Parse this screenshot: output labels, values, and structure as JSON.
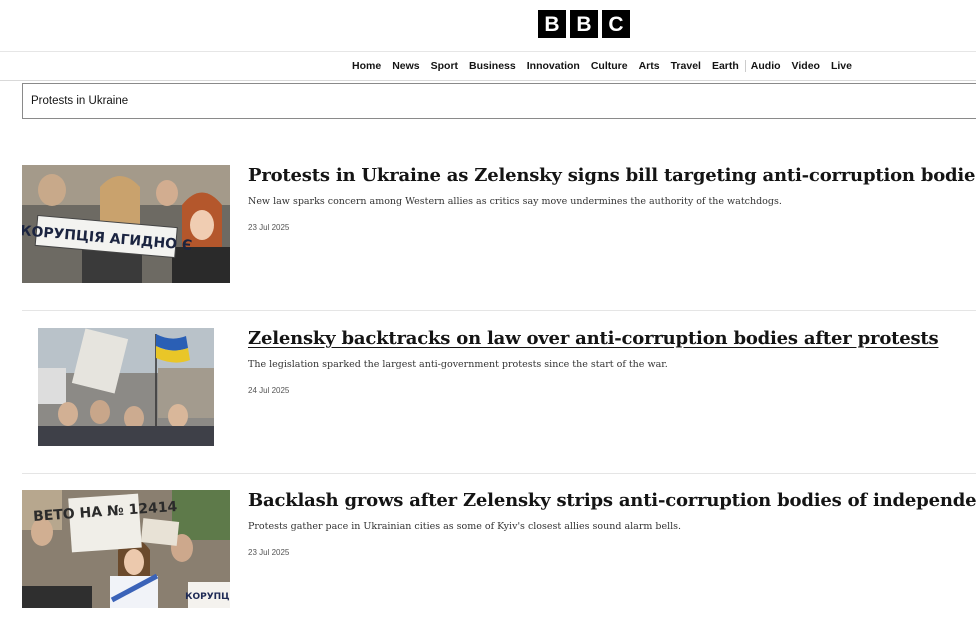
{
  "logo": {
    "letters": [
      "B",
      "B",
      "C"
    ]
  },
  "nav": {
    "items": [
      "Home",
      "News",
      "Sport",
      "Business",
      "Innovation",
      "Culture",
      "Arts",
      "Travel",
      "Earth",
      "Audio",
      "Video",
      "Live"
    ]
  },
  "search": {
    "value": "Protests in Ukraine"
  },
  "results": [
    {
      "title": "Protests in Ukraine as Zelensky signs bill targeting anti-corruption bodies",
      "summary": "New law sparks concern among Western allies as critics say move undermines the authority of the watchdogs.",
      "date": "23 Jul 2025",
      "sign_text": "КОРУПЦІЯ АГИДНО Є"
    },
    {
      "title": "Zelensky backtracks on law over anti-corruption bodies after protests",
      "summary": "The legislation sparked the largest anti-government protests since the start of the war.",
      "date": "24 Jul 2025"
    },
    {
      "title": "Backlash grows after Zelensky strips anti-corruption bodies of independence",
      "summary": "Protests gather pace in Ukrainian cities as some of Kyiv's closest allies sound alarm bells.",
      "date": "23 Jul 2025",
      "sign_text": "ВЕТО НА № 12414",
      "sign_text_2": "КОРУПЦІ"
    }
  ]
}
